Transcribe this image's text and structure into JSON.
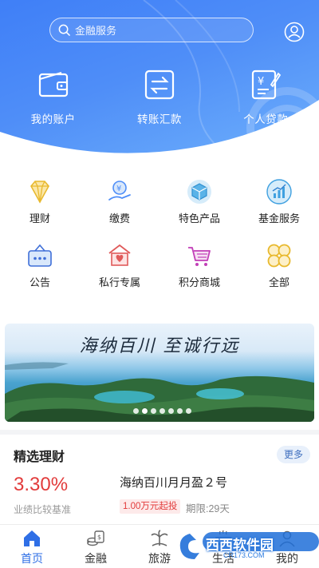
{
  "search": {
    "placeholder": "金融服务"
  },
  "quick_actions": [
    {
      "label": "我的账户",
      "icon": "wallet-icon"
    },
    {
      "label": "转账汇款",
      "icon": "transfer-icon"
    },
    {
      "label": "个人贷款",
      "icon": "loan-icon"
    }
  ],
  "services": [
    {
      "label": "理财",
      "icon": "diamond-icon"
    },
    {
      "label": "缴费",
      "icon": "payment-icon"
    },
    {
      "label": "特色产品",
      "icon": "cube-icon"
    },
    {
      "label": "基金服务",
      "icon": "fund-chart-icon"
    },
    {
      "label": "公告",
      "icon": "notice-icon"
    },
    {
      "label": "私行专属",
      "icon": "private-bank-icon"
    },
    {
      "label": "积分商城",
      "icon": "cart-icon"
    },
    {
      "label": "全部",
      "icon": "all-grid-icon"
    }
  ],
  "banner": {
    "slogan": "海纳百川 至诚行远",
    "slide_count": 7,
    "active_slide": 1
  },
  "featured": {
    "title": "精选理财",
    "more_label": "更多",
    "product": {
      "rate": "3.30%",
      "rate_label": "业绩比较基准",
      "name": "海纳百川月月盈２号",
      "min_tag": "1.00万元起投",
      "term": "期限:29天"
    }
  },
  "tabs": [
    {
      "label": "首页",
      "icon": "home-icon",
      "active": true
    },
    {
      "label": "金融",
      "icon": "finance-icon",
      "active": false
    },
    {
      "label": "旅游",
      "icon": "travel-icon",
      "active": false
    },
    {
      "label": "生活",
      "icon": "life-icon",
      "active": false
    },
    {
      "label": "我的",
      "icon": "profile-icon",
      "active": false
    }
  ],
  "watermark": {
    "brand": "西西软件园",
    "domain": "CR173.COM"
  },
  "colors": {
    "header_blue": "#4f8ef8",
    "accent_blue": "#2f6fe6",
    "rate_red": "#e23b3b",
    "icon_gold": "#e8b92e"
  }
}
